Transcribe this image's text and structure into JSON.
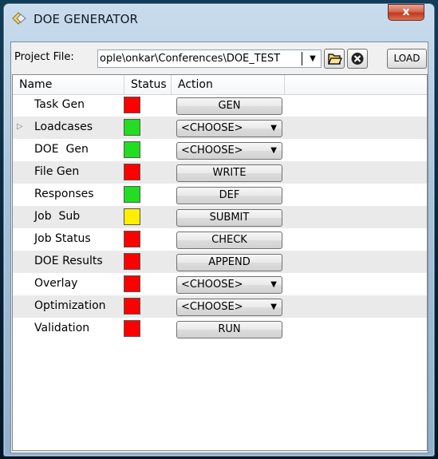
{
  "window": {
    "title": "DOE GENERATOR",
    "close_glyph": "x"
  },
  "project": {
    "label": "Project File:",
    "value": "ople\\onkar\\Conferences\\DOE_TEST",
    "load_label": "LOAD"
  },
  "table": {
    "headers": {
      "name": "Name",
      "status": "Status",
      "action": "Action"
    },
    "rows": [
      {
        "name": "Task Gen",
        "status_color": "#ff0000",
        "action": "GEN",
        "action_type": "button"
      },
      {
        "name": "Loadcases",
        "status_color": "#22dd22",
        "action": "<CHOOSE>",
        "action_type": "combo",
        "expandable": true
      },
      {
        "name": "DOE  Gen",
        "status_color": "#22dd22",
        "action": "<CHOOSE>",
        "action_type": "combo"
      },
      {
        "name": "File Gen",
        "status_color": "#ff0000",
        "action": "WRITE",
        "action_type": "button"
      },
      {
        "name": "Responses",
        "status_color": "#22dd22",
        "action": "DEF",
        "action_type": "button"
      },
      {
        "name": "Job  Sub",
        "status_color": "#ffee00",
        "action": "SUBMIT",
        "action_type": "button"
      },
      {
        "name": "Job Status",
        "status_color": "#ff0000",
        "action": "CHECK",
        "action_type": "button"
      },
      {
        "name": "DOE Results",
        "status_color": "#ff0000",
        "action": "APPEND",
        "action_type": "button"
      },
      {
        "name": "Overlay",
        "status_color": "#ff0000",
        "action": "<CHOOSE>",
        "action_type": "combo"
      },
      {
        "name": "Optimization",
        "status_color": "#ff0000",
        "action": "<CHOOSE>",
        "action_type": "combo"
      },
      {
        "name": "Validation",
        "status_color": "#ff0000",
        "action": "RUN",
        "action_type": "button"
      }
    ]
  },
  "icons": {
    "app": "diamond-app-icon",
    "folder": "folder-open-icon",
    "clear": "clear-circle-x-icon",
    "dropdown": "triangle-down-icon",
    "expander": "triangle-right-icon"
  }
}
